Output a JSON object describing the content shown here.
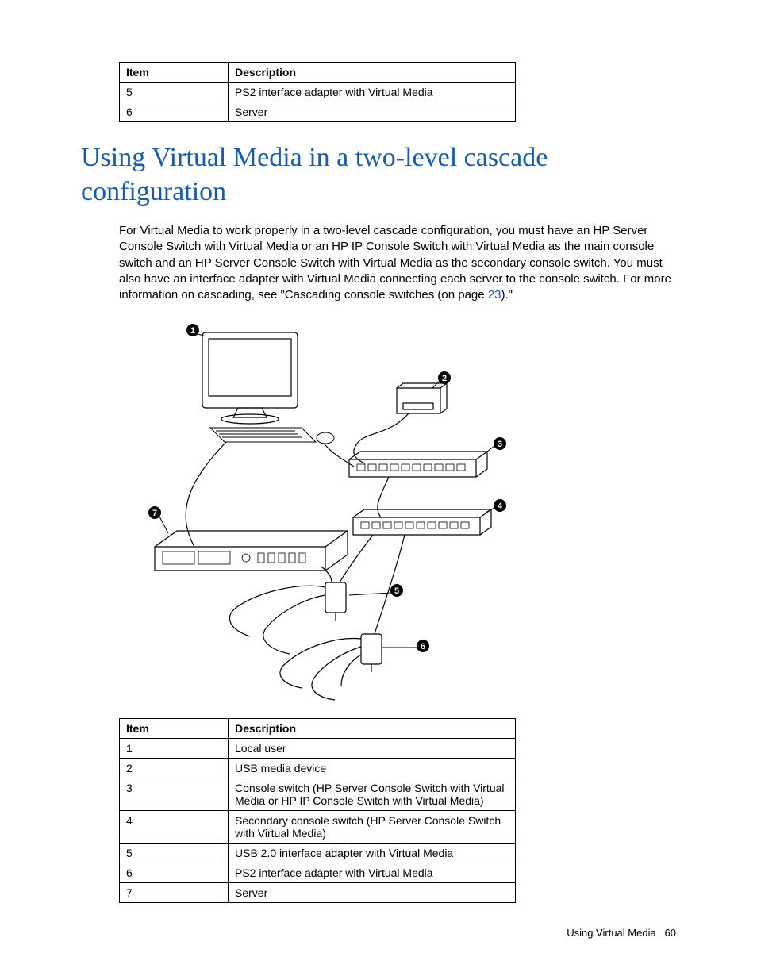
{
  "table_top": {
    "header_item": "Item",
    "header_desc": "Description",
    "rows": [
      {
        "item": "5",
        "desc": "PS2 interface adapter with Virtual Media"
      },
      {
        "item": "6",
        "desc": "Server"
      }
    ]
  },
  "heading": "Using Virtual Media in a two-level cascade configuration",
  "paragraph": {
    "pre": "For Virtual Media to work properly in a two-level cascade configuration, you must have an HP Server Console Switch with Virtual Media or an HP IP Console Switch with Virtual Media as the main console switch and an HP Server Console Switch with Virtual Media as the secondary console switch. You must also have an interface adapter with Virtual Media connecting each server to the console switch. For more information on cascading, see \"Cascading console switches (on page ",
    "link": "23",
    "post": ").\""
  },
  "diagram": {
    "callouts": [
      {
        "n": "1",
        "label": "Local user"
      },
      {
        "n": "2",
        "label": "USB media device"
      },
      {
        "n": "3",
        "label": "Console switch"
      },
      {
        "n": "4",
        "label": "Secondary console switch"
      },
      {
        "n": "5",
        "label": "USB 2.0 interface adapter"
      },
      {
        "n": "6",
        "label": "PS2 interface adapter"
      },
      {
        "n": "7",
        "label": "Server"
      }
    ]
  },
  "table_bottom": {
    "header_item": "Item",
    "header_desc": "Description",
    "rows": [
      {
        "item": "1",
        "desc": "Local user"
      },
      {
        "item": "2",
        "desc": "USB media device"
      },
      {
        "item": "3",
        "desc": "Console switch (HP Server Console Switch with Virtual Media or HP IP Console Switch with Virtual Media)"
      },
      {
        "item": "4",
        "desc": "Secondary console switch (HP Server Console Switch with Virtual Media)"
      },
      {
        "item": "5",
        "desc": "USB 2.0 interface adapter with Virtual Media"
      },
      {
        "item": "6",
        "desc": "PS2 interface adapter with Virtual Media"
      },
      {
        "item": "7",
        "desc": "Server"
      }
    ]
  },
  "footer": {
    "section": "Using Virtual Media",
    "page": "60"
  }
}
